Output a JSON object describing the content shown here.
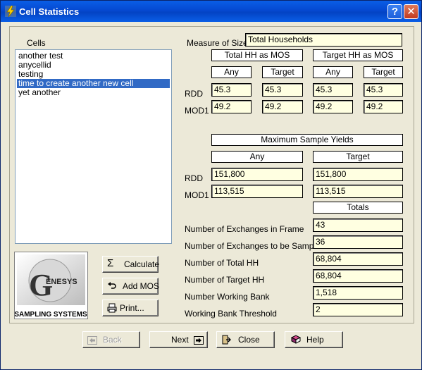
{
  "window": {
    "title": "Cell Statistics",
    "help_button": "?",
    "close_button": "✕"
  },
  "cells": {
    "label": "Cells",
    "items": [
      "another test",
      "anycellid",
      "testing",
      "time to create another new cell",
      "yet another"
    ],
    "selected_index": 3
  },
  "mos": {
    "label": "Measure of Size",
    "value": "Total Households",
    "group_total": "Total HH as MOS",
    "group_target": "Target HH as MOS",
    "sub_any": "Any",
    "sub_target": "Target",
    "row_rdd": "RDD",
    "row_mod1": "MOD1",
    "rdd_values": [
      "45.3",
      "45.3",
      "45.3",
      "45.3"
    ],
    "mod1_values": [
      "49.2",
      "49.2",
      "49.2",
      "49.2"
    ]
  },
  "yields": {
    "title": "Maximum Sample Yields",
    "col_any": "Any",
    "col_target": "Target",
    "row_rdd": "RDD",
    "row_mod1": "MOD1",
    "rdd_any": "151,800",
    "rdd_target": "151,800",
    "mod1_any": "113,515",
    "mod1_target": "113,515"
  },
  "totals": {
    "header": "Totals",
    "rows": [
      {
        "label": "Number of Exchanges in Frame",
        "value": "43"
      },
      {
        "label": "Number of Exchanges to be Sampled",
        "value": "36"
      },
      {
        "label": "Number of Total HH",
        "value": "68,804"
      },
      {
        "label": "Number of Target HH",
        "value": "68,804"
      },
      {
        "label": "Number Working Bank",
        "value": "1,518"
      },
      {
        "label": "Working  Bank Threshold",
        "value": "2"
      }
    ]
  },
  "logo": {
    "brand_initial": "G",
    "brand_rest": "ENESYS",
    "tagline": "SAMPLING SYSTEMS"
  },
  "actions": {
    "calculate": "Calculate",
    "add_mos": "Add MOS",
    "print": "Print..."
  },
  "nav": {
    "back": "Back",
    "next": "Next",
    "close": "Close",
    "help": "Help"
  },
  "colors": {
    "value_field_bg": "#ffffe1",
    "selection": "#316ac5",
    "titlebar": "#0549d1"
  }
}
